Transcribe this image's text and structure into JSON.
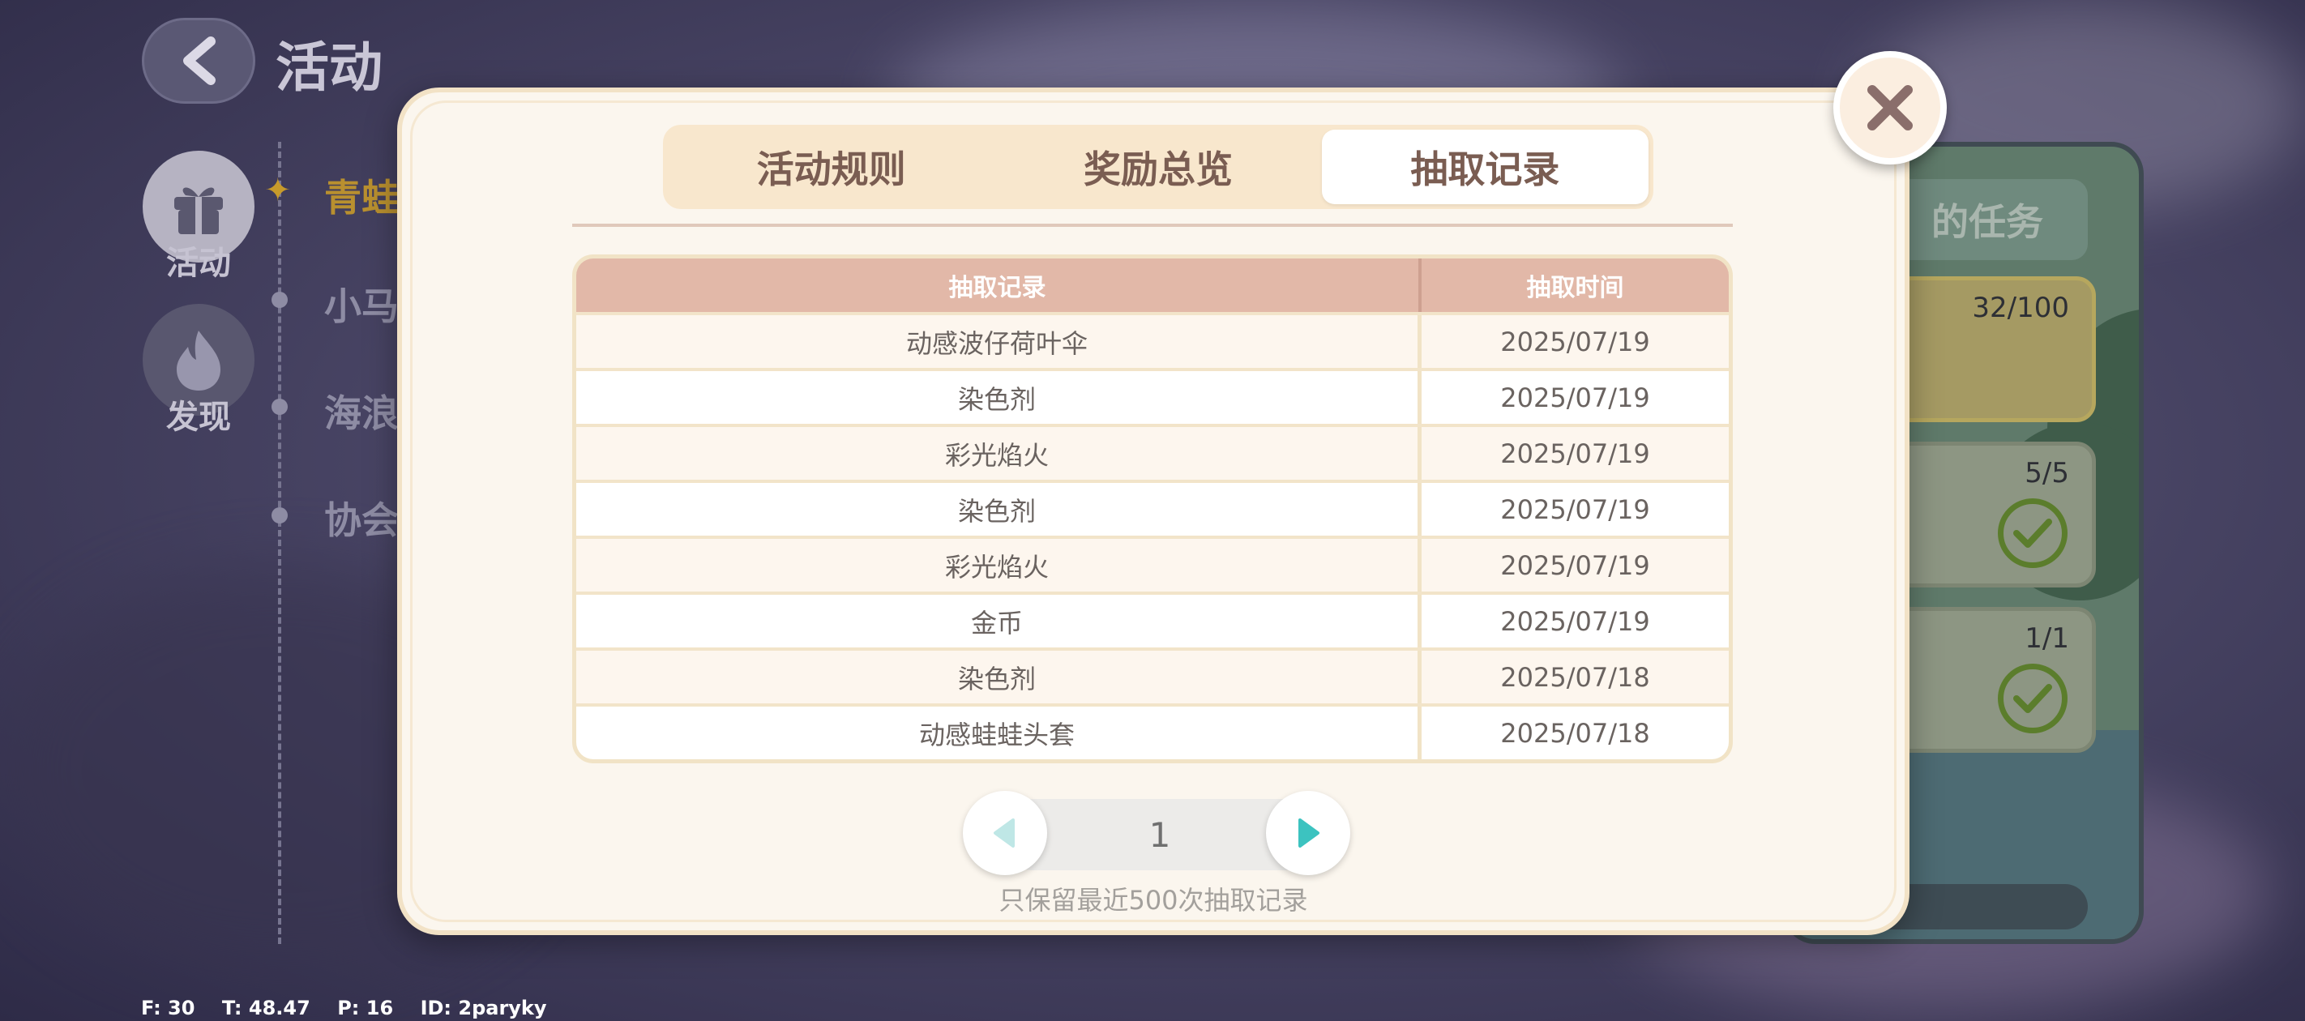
{
  "page": {
    "title": "活动"
  },
  "sidebar": [
    {
      "label": "活动",
      "icon": "gift-icon",
      "active": true
    },
    {
      "label": "发现",
      "icon": "fire-icon",
      "active": false
    }
  ],
  "events": [
    {
      "label": "青蛙",
      "active": true
    },
    {
      "label": "小马",
      "active": false
    },
    {
      "label": "海浪",
      "active": false
    },
    {
      "label": "协会",
      "active": false
    }
  ],
  "tasks": {
    "header": "的任务",
    "items": [
      {
        "count": "32/100",
        "done": false
      },
      {
        "count": "5/5",
        "done": true
      },
      {
        "count": "1/1",
        "done": true
      }
    ]
  },
  "modal": {
    "tabs": [
      "活动规则",
      "奖励总览",
      "抽取记录"
    ],
    "active_tab": 2,
    "table": {
      "headers": [
        "抽取记录",
        "抽取时间"
      ],
      "rows": [
        [
          "动感波仔荷叶伞",
          "2025/07/19"
        ],
        [
          "染色剂",
          "2025/07/19"
        ],
        [
          "彩光焰火",
          "2025/07/19"
        ],
        [
          "染色剂",
          "2025/07/19"
        ],
        [
          "彩光焰火",
          "2025/07/19"
        ],
        [
          "金币",
          "2025/07/19"
        ],
        [
          "染色剂",
          "2025/07/18"
        ],
        [
          "动感蛙蛙头套",
          "2025/07/18"
        ]
      ]
    },
    "pager": {
      "page": "1"
    },
    "footnote": "只保留最近500次抽取记录"
  },
  "debug": "F: 30    T: 48.47    P: 16    ID: 2paryky",
  "colors": {
    "accent_teal": "#3cc3c0",
    "header_row": "#e2b8a8",
    "tab_text": "#7a5d52",
    "close_x": "#8a6e6b"
  }
}
